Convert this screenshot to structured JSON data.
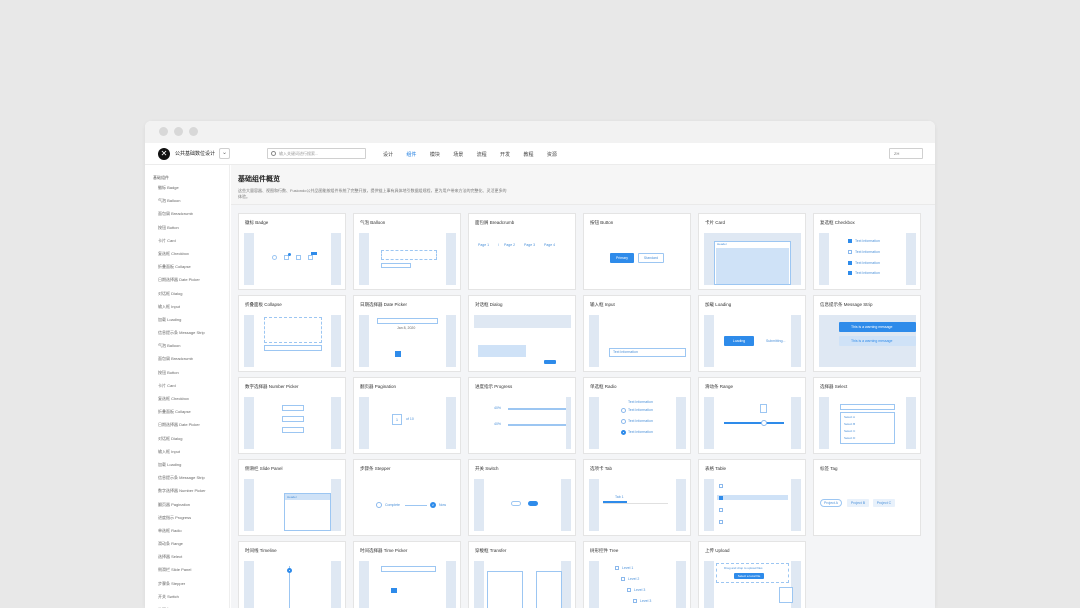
{
  "header": {
    "brand": "公共基础数位设计",
    "search_placeholder": "输入关键词进行搜索...",
    "nav": [
      "设计",
      "组件",
      "模块",
      "场景",
      "流程",
      "开发",
      "教程",
      "资源"
    ],
    "active_nav": "组件",
    "lang": "ZH"
  },
  "sidebar": {
    "title": "基础组件",
    "items": [
      "徽标 Badge",
      "气泡 Balloon",
      "面包屑 Breadcrumb",
      "按钮 Button",
      "卡片 Card",
      "复选框 Checkbox",
      "折叠面板 Collapse",
      "日期选择器 Date Picker",
      "对话框 Dialog",
      "输入框 Input",
      "加载 Loading",
      "信息提示条 Message Strip",
      "气泡 Balloon",
      "面包屑 Breadcrumb",
      "按钮 Button",
      "卡片 Card",
      "复选框 Checkbox",
      "折叠面板 Collapse",
      "日期选择器 Date Picker",
      "对话框 Dialog",
      "输入框 Input",
      "加载 Loading",
      "信息提示条 Message Strip",
      "数字选择器 Number Picker",
      "翻页器 Pagination",
      "进度指示 Progress",
      "单选框 Radio",
      "滑动条 Range",
      "选择器 Select",
      "侧滑栏 Slide Panel",
      "步骤条 Stepper",
      "开关 Switch",
      "选项卡 Tab"
    ]
  },
  "hero": {
    "title": "基础组件概览",
    "desc": "这些大量容器、视图和行数、Fusiondo公共品图能按组件系统了完整开放，提供链上事有具体地引数据组规程，更为用户带来方法的完整化、灵活更多的体验。"
  },
  "cards": [
    {
      "title": "徽标 Badge"
    },
    {
      "title": "气泡 Balloon"
    },
    {
      "title": "面包屑 Breadcrumb"
    },
    {
      "title": "按钮 Button"
    },
    {
      "title": "卡片 Card"
    },
    {
      "title": "复选框 Checkbox"
    },
    {
      "title": "折叠面板 Collapse"
    },
    {
      "title": "日期选择器 Date Picker"
    },
    {
      "title": "对话框 Dialog"
    },
    {
      "title": "输入框 Input"
    },
    {
      "title": "加载 Loading"
    },
    {
      "title": "信息提示条 Message Strip"
    },
    {
      "title": "数字选择器 Number Picker"
    },
    {
      "title": "翻页器 Pagination"
    },
    {
      "title": "进度指示 Progress"
    },
    {
      "title": "单选框 Radio"
    },
    {
      "title": "滑动条 Range"
    },
    {
      "title": "选择器 Select"
    },
    {
      "title": "侧滑栏 Slide Panel"
    },
    {
      "title": "步骤条 Stepper"
    },
    {
      "title": "开关 Switch"
    },
    {
      "title": "选项卡 Tab"
    },
    {
      "title": "表格 Table"
    },
    {
      "title": "标签 Tag"
    },
    {
      "title": "时间线 Timeline"
    },
    {
      "title": "时间选择器 Time Picker"
    },
    {
      "title": "穿梭框 Transfer"
    },
    {
      "title": "树形控件 Tree"
    },
    {
      "title": "上传 Upload"
    }
  ],
  "previews": {
    "breadcrumb": [
      "Page 1",
      "Page 2",
      "Page 3",
      "Page 4"
    ],
    "button": {
      "primary": "Primary",
      "standard": "Standard"
    },
    "card": {
      "header": "Header"
    },
    "checkbox": [
      "Text Information",
      "Text Information",
      "Text Information",
      "Text Information"
    ],
    "datepicker": {
      "month": "Jan 8, 2020"
    },
    "input": {
      "value": "Text Information"
    },
    "loading": {
      "button": "Loading",
      "text": "Submitting..."
    },
    "message": [
      "This is a warning message",
      "This is a warning message"
    ],
    "progress": [
      "40%",
      "40%"
    ],
    "radio": [
      "Text Information",
      "Text Information",
      "Text Information",
      "Text Information"
    ],
    "select": {
      "options": [
        "Select A",
        "Select B",
        "Select C",
        "Select D"
      ]
    },
    "slidepanel": {
      "title": "Header"
    },
    "stepper": {
      "done": "Complete",
      "current": "Now",
      "step": "2"
    },
    "tab": {
      "active": "Tab 1"
    },
    "tag": [
      "Project A",
      "Project B",
      "Project C"
    ],
    "upload": {
      "hint": "Drag and drop to upload files",
      "button": "Select a local file"
    },
    "tree": [
      "Level 1",
      "Level 2",
      "Level 3",
      "Level 3"
    ],
    "pagination": {
      "page": "1",
      "of": "of 10"
    }
  }
}
